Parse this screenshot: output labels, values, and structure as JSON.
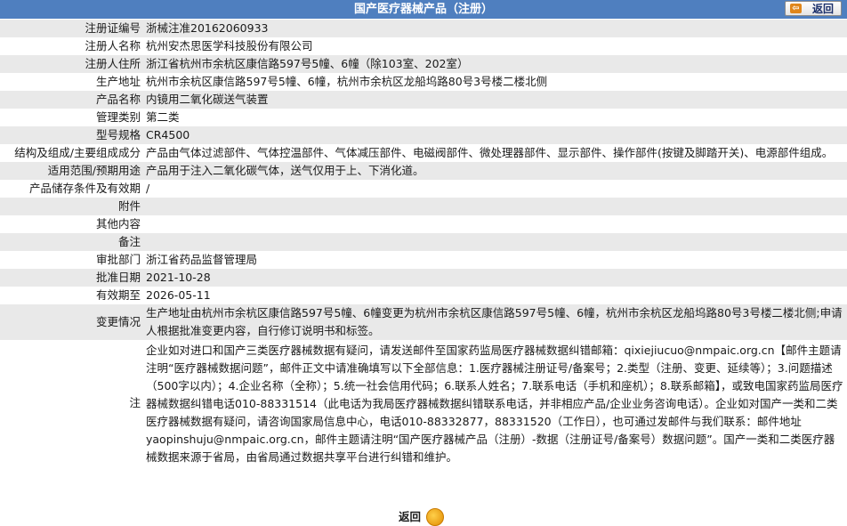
{
  "header": {
    "title": "国产医疗器械产品（注册）",
    "back_label": "返回"
  },
  "rows": [
    {
      "label": "注册证编号",
      "value": "浙械注准20162060933"
    },
    {
      "label": "注册人名称",
      "value": "杭州安杰思医学科技股份有限公司"
    },
    {
      "label": "注册人住所",
      "value": "浙江省杭州市余杭区康信路597号5幢、6幢（除103室、202室）"
    },
    {
      "label": "生产地址",
      "value": "杭州市余杭区康信路597号5幢、6幢，杭州市余杭区龙船坞路80号3号楼二楼北侧"
    },
    {
      "label": "产品名称",
      "value": "内镜用二氧化碳送气装置"
    },
    {
      "label": "管理类别",
      "value": "第二类"
    },
    {
      "label": "型号规格",
      "value": "CR4500"
    },
    {
      "label": "结构及组成/主要组成成分",
      "value": "产品由气体过滤部件、气体控温部件、气体减压部件、电磁阀部件、微处理器部件、显示部件、操作部件(按键及脚踏开关)、电源部件组成。"
    },
    {
      "label": "适用范围/预期用途",
      "value": "产品用于注入二氧化碳气体，送气仅用于上、下消化道。"
    },
    {
      "label": "产品储存条件及有效期",
      "value": "/"
    },
    {
      "label": "附件",
      "value": ""
    },
    {
      "label": "其他内容",
      "value": ""
    },
    {
      "label": "备注",
      "value": ""
    },
    {
      "label": "审批部门",
      "value": "浙江省药品监督管理局"
    },
    {
      "label": "批准日期",
      "value": "2021-10-28"
    },
    {
      "label": "有效期至",
      "value": "2026-05-11"
    },
    {
      "label": "变更情况",
      "value": "生产地址由杭州市余杭区康信路597号5幢、6幢变更为杭州市余杭区康信路597号5幢、6幢，杭州市余杭区龙船坞路80号3号楼二楼北侧;申请人根据批准变更内容，自行修订说明书和标签。"
    }
  ],
  "note": {
    "label": "注",
    "text": "企业如对进口和国产三类医疗器械数据有疑问，请发送邮件至国家药监局医疗器械数据纠错邮箱：qixiejiucuo@nmpaic.org.cn【邮件主题请注明“医疗器械数据问题”，邮件正文中请准确填写以下全部信息：1.医疗器械注册证号/备案号；2.类型（注册、变更、延续等）；3.问题描述（500字以内）；4.企业名称（全称）；5.统一社会信用代码；6.联系人姓名；7.联系电话（手机和座机）；8.联系邮箱】，或致电国家药监局医疗器械数据纠错电话010-88331514（此电话为我局医疗器械数据纠错联系电话，并非相应产品/企业业务咨询电话）。企业如对国产一类和二类医疗器械数据有疑问，请咨询国家局信息中心，电话010-88332877，88331520（工作日），也可通过发邮件与我们联系：邮件地址yaopinshuju@nmpaic.org.cn，邮件主题请注明“国产医疗器械产品（注册）-数据（注册证号/备案号）数据问题”。国产一类和二类医疗器械数据来源于省局，由省局通过数据共享平台进行纠错和维护。"
  },
  "footer": {
    "back_label": "返回"
  }
}
